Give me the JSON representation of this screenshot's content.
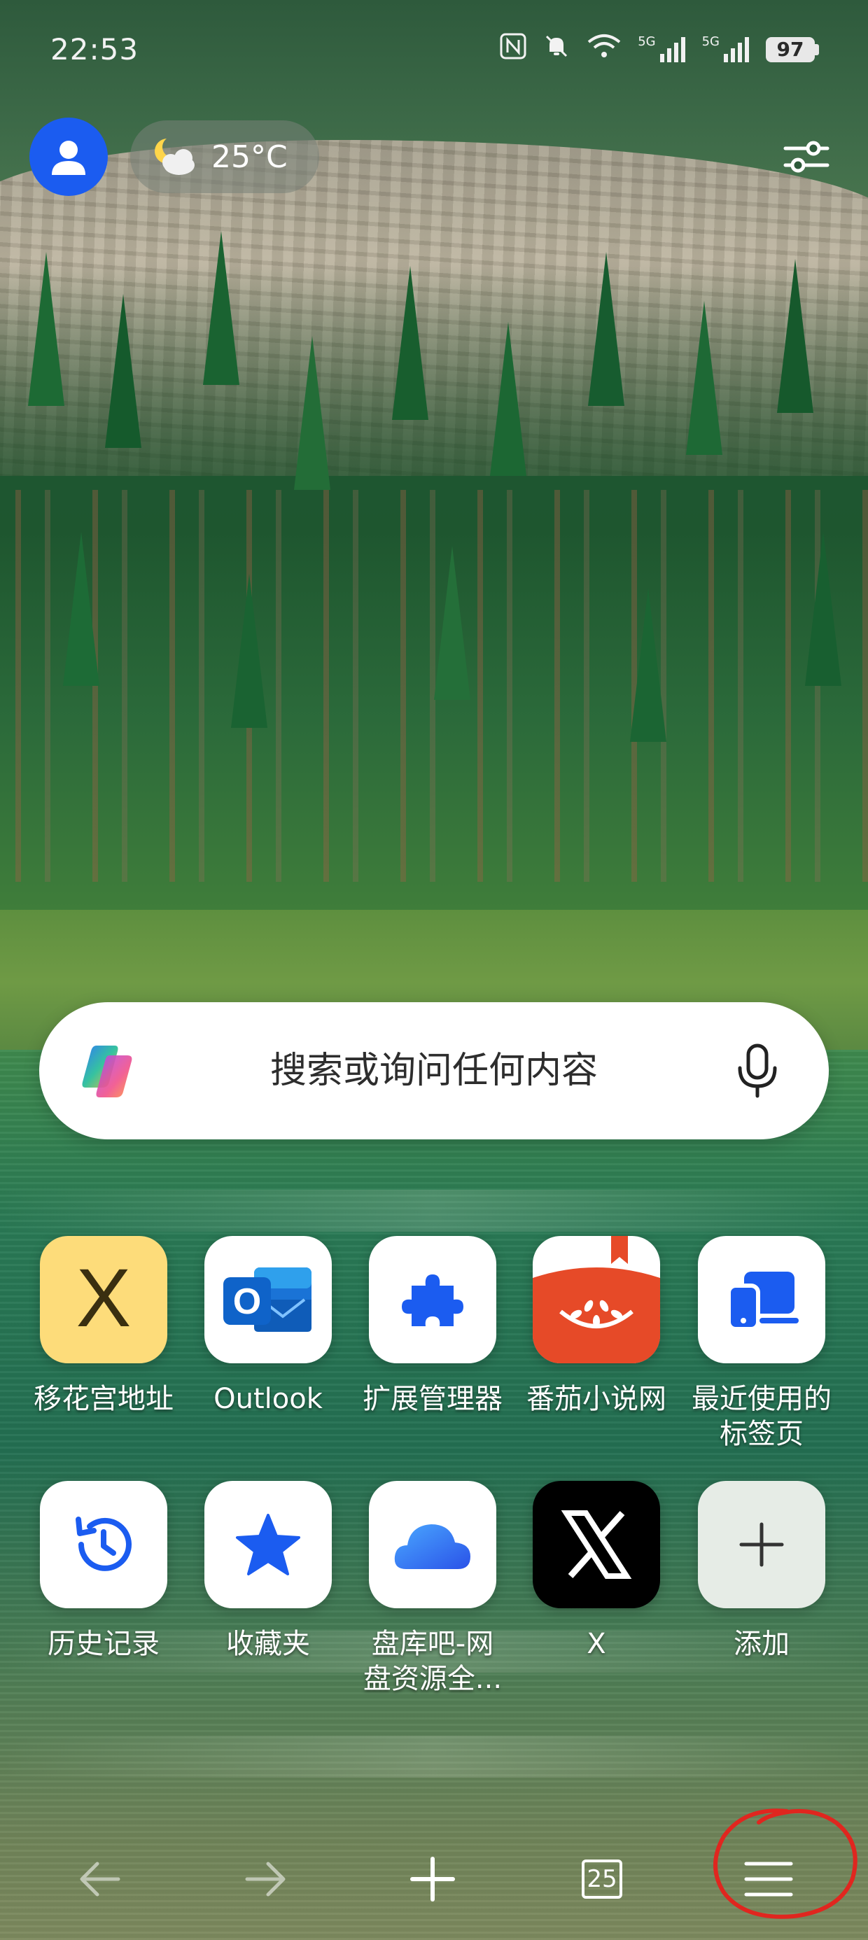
{
  "status_bar": {
    "time": "22:53",
    "icons": [
      "nfc-icon",
      "mute-bell-icon",
      "wifi-icon",
      "signal-5g-icon",
      "signal-5g-icon"
    ],
    "signal_label_1": "5G",
    "signal_label_2": "5G",
    "battery": "97"
  },
  "header": {
    "weather_icon": "partly-cloudy-night-icon",
    "temperature": "25°C"
  },
  "search": {
    "placeholder": "搜索或询问任何内容",
    "logo": "copilot-icon",
    "mic": "microphone-icon"
  },
  "shortcuts": [
    {
      "label": "移花宫地址",
      "icon": "x-letter-icon",
      "icon_bg": "#fddc7a"
    },
    {
      "label": "Outlook",
      "icon": "outlook-icon",
      "icon_bg": "#ffffff"
    },
    {
      "label": "扩展管理器",
      "icon": "puzzle-icon",
      "icon_bg": "#ffffff"
    },
    {
      "label": "番茄小说网",
      "icon": "tomato-icon",
      "icon_bg": "#e64a28"
    },
    {
      "label": "最近使用的\n标签页",
      "icon": "recent-tabs-icon",
      "icon_bg": "#ffffff"
    },
    {
      "label": "历史记录",
      "icon": "history-icon",
      "icon_bg": "#ffffff"
    },
    {
      "label": "收藏夹",
      "icon": "star-icon",
      "icon_bg": "#ffffff"
    },
    {
      "label": "盘库吧-网\n盘资源全...",
      "icon": "cloud-icon",
      "icon_bg": "#ffffff"
    },
    {
      "label": "X",
      "icon": "x-logo-icon",
      "icon_bg": "#000000"
    },
    {
      "label": "添加",
      "icon": "plus-icon",
      "icon_bg": "#e6ece6"
    }
  ],
  "bottom_nav": {
    "tab_count": "25",
    "items": [
      "back-arrow-icon",
      "forward-arrow-icon",
      "new-tab-plus-icon",
      "tabs-icon",
      "menu-icon"
    ]
  },
  "colors": {
    "accent_blue": "#1b5cf0",
    "annotation_red": "#e0261f"
  }
}
